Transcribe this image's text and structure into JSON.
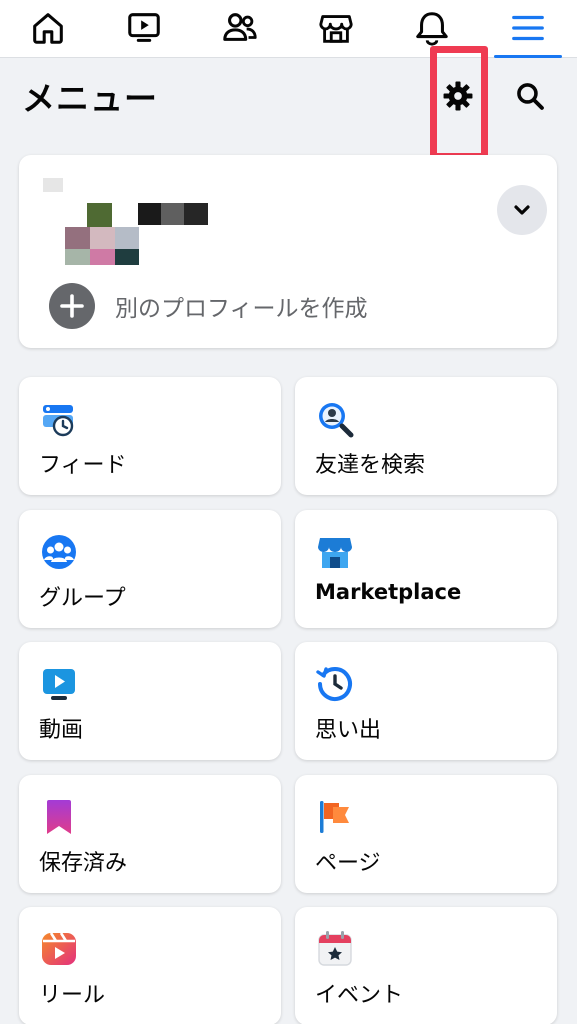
{
  "colors": {
    "accent": "#1877f2",
    "background": "#f0f2f5",
    "highlight": "#ef3b52",
    "icon_gray": "#65676b"
  },
  "topnav": {
    "items": [
      {
        "icon": "home-icon",
        "active": false
      },
      {
        "icon": "video-icon",
        "active": false
      },
      {
        "icon": "friends-icon",
        "active": false
      },
      {
        "icon": "marketplace-icon",
        "active": false
      },
      {
        "icon": "bell-icon",
        "active": false
      },
      {
        "icon": "menu-icon",
        "active": true
      }
    ]
  },
  "header": {
    "title": "メニュー",
    "settings_icon": "gear-icon",
    "search_icon": "search-icon"
  },
  "profile": {
    "expand_icon": "chevron-down-icon",
    "create_label": "別のプロフィールを作成"
  },
  "shortcuts": [
    {
      "label": "フィード",
      "icon": "feed-icon"
    },
    {
      "label": "友達を検索",
      "icon": "find-friends-icon"
    },
    {
      "label": "グループ",
      "icon": "groups-icon"
    },
    {
      "label": "Marketplace",
      "icon": "marketplace-store-icon"
    },
    {
      "label": "動画",
      "icon": "video-tile-icon"
    },
    {
      "label": "思い出",
      "icon": "memories-icon"
    },
    {
      "label": "保存済み",
      "icon": "saved-bookmark-icon"
    },
    {
      "label": "ページ",
      "icon": "pages-flag-icon"
    },
    {
      "label": "リール",
      "icon": "reels-icon"
    },
    {
      "label": "イベント",
      "icon": "events-calendar-icon"
    }
  ]
}
